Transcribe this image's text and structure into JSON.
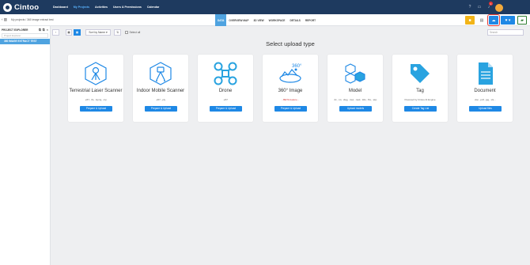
{
  "app": {
    "logo_text": "Cintoo"
  },
  "nav": {
    "links": [
      "Dashboard",
      "My Projects",
      "Activities",
      "Users & Permissions",
      "Calendar"
    ],
    "notification_count": "1"
  },
  "breadcrumb": "My projects  /  360 image extract test",
  "tabs": [
    "DATA",
    "OVERVIEW MAP",
    "3D VIEW",
    "WORKSPACE",
    "DETAILS",
    "REPORT"
  ],
  "sidebar": {
    "title": "PROJECT EXPLORER",
    "search_placeholder": "Project Explorer",
    "items": [
      {
        "label": "360 IMAGE EXTRACT TEST"
      }
    ]
  },
  "toolbar": {
    "sort_label": "Sort by Name",
    "select_all": "Select all",
    "search_placeholder": "Search"
  },
  "heading": "Select upload type",
  "cards": [
    {
      "title": "Terrestrial Laser Scanner",
      "formats": ".e57, .fls, .lsproj, .rcp",
      "button": "Prepare & Upload",
      "icon": "laser-scanner-icon"
    },
    {
      "title": "Indoor Mobile Scanner",
      "formats": ".e57, .ply",
      "button": "Prepare & Upload",
      "icon": "mobile-scanner-icon"
    },
    {
      "title": "Drone",
      "formats": ".e57",
      "button": "Prepare & Upload",
      "icon": "drone-icon"
    },
    {
      "title": "360° Image",
      "formats": "- BETA feature -",
      "button": "Prepare & Upload",
      "icon": "360-image-icon"
    },
    {
      "title": "Model",
      "formats": ".ifc, .rvt, .dwg, .nwc, .nwd, .3ds, .fbx, .skp",
      "button": "Upload models",
      "icon": "model-icon"
    },
    {
      "title": "Tag",
      "formats": "Powered by Cintoo AI Engine",
      "button": "Create Tag List",
      "icon": "tag-icon"
    },
    {
      "title": "Document",
      "formats": ".doc, .pdf, .jpg, .xls...",
      "button": "Upload files",
      "icon": "document-icon"
    }
  ],
  "colors": {
    "nav_bg": "#1e3a5f",
    "accent": "#1e88e5",
    "active_tab": "#4fa3e0",
    "highlight": "#e53935"
  }
}
